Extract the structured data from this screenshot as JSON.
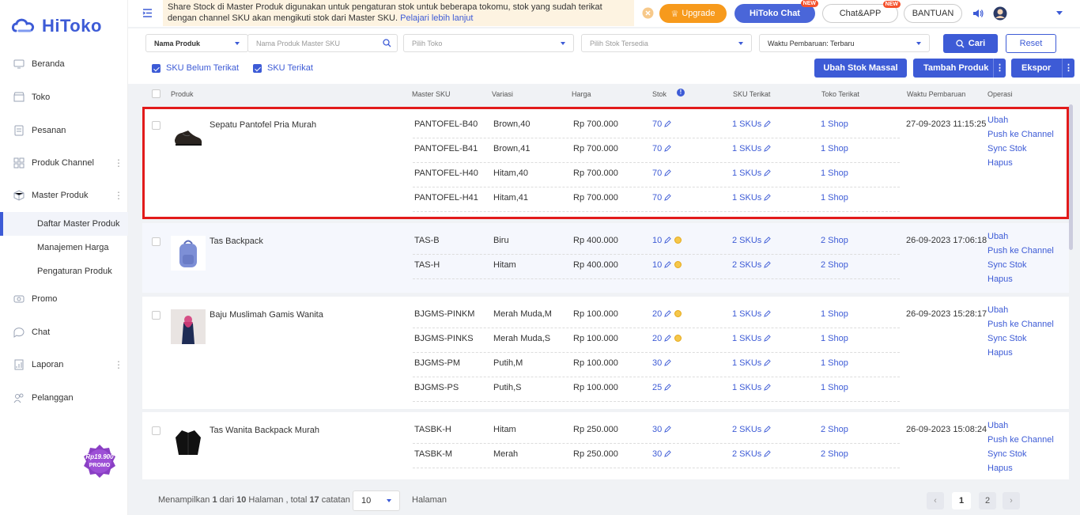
{
  "app": {
    "logo_text": "HiToko"
  },
  "sidebar": {
    "items": [
      {
        "label": "Beranda",
        "icon": "monitor-icon"
      },
      {
        "label": "Toko",
        "icon": "store-icon"
      },
      {
        "label": "Pesanan",
        "icon": "list-icon"
      },
      {
        "label": "Produk Channel",
        "icon": "grid-icon"
      },
      {
        "label": "Master Produk",
        "icon": "cube-icon"
      },
      {
        "label": "Promo",
        "icon": "promo-icon"
      },
      {
        "label": "Chat",
        "icon": "chat-icon"
      },
      {
        "label": "Laporan",
        "icon": "report-icon"
      },
      {
        "label": "Pelanggan",
        "icon": "users-icon"
      }
    ],
    "subitems": [
      {
        "label": "Daftar Master Produk"
      },
      {
        "label": "Manajemen Harga"
      },
      {
        "label": "Pengaturan Produk"
      }
    ],
    "promo_badge": {
      "price": "Rp19.900",
      "label": "PROMO"
    }
  },
  "topbar": {
    "notice_text": "Share Stock di Master Produk digunakan untuk pengaturan stok untuk beberapa tokomu, stok yang sudah terikat dengan channel SKU akan mengikuti stok dari Master SKU.",
    "notice_link": "Pelajari lebih lanjut",
    "upgrade": "Upgrade",
    "hitoko_chat": "HiToko Chat",
    "chat_app": "Chat&APP",
    "new_tag": "NEW",
    "bantuan": "BANTUAN"
  },
  "filters": {
    "search_field": "Nama Produk",
    "search_placeholder": "Nama Produk Master SKU",
    "toko_placeholder": "Pilih Toko",
    "stok_placeholder": "Pilih Stok Tersedia",
    "sort": "Waktu Pembaruan: Terbaru",
    "cari": "Cari",
    "reset": "Reset",
    "sku_belum": "SKU Belum Terikat",
    "sku_terikat": "SKU Terikat",
    "ubah_stok": "Ubah Stok Massal",
    "tambah_produk": "Tambah Produk",
    "ekspor": "Ekspor"
  },
  "table": {
    "headers": [
      "Produk",
      "Master SKU",
      "Variasi",
      "Harga",
      "Stok",
      "SKU Terikat",
      "Toko Terikat",
      "Waktu Pembaruan",
      "Operasi"
    ],
    "operations": [
      "Ubah",
      "Push ke Channel",
      "Sync Stok",
      "Hapus"
    ],
    "products": [
      {
        "name": "Sepatu Pantofel Pria Murah",
        "updated": "27-09-2023 11:15:25",
        "thumb": "shoe",
        "rows": [
          {
            "sku": "PANTOFEL-B40",
            "variant": "Brown,40",
            "price": "Rp 700.000",
            "stock": "70",
            "coin": false,
            "skus": "1 SKUs",
            "shops": "1 Shop"
          },
          {
            "sku": "PANTOFEL-B41",
            "variant": "Brown,41",
            "price": "Rp 700.000",
            "stock": "70",
            "coin": false,
            "skus": "1 SKUs",
            "shops": "1 Shop"
          },
          {
            "sku": "PANTOFEL-H40",
            "variant": "Hitam,40",
            "price": "Rp 700.000",
            "stock": "70",
            "coin": false,
            "skus": "1 SKUs",
            "shops": "1 Shop"
          },
          {
            "sku": "PANTOFEL-H41",
            "variant": "Hitam,41",
            "price": "Rp 700.000",
            "stock": "70",
            "coin": false,
            "skus": "1 SKUs",
            "shops": "1 Shop"
          }
        ]
      },
      {
        "name": "Tas Backpack",
        "updated": "26-09-2023 17:06:18",
        "thumb": "backpack",
        "rows": [
          {
            "sku": "TAS-B",
            "variant": "Biru",
            "price": "Rp 400.000",
            "stock": "10",
            "coin": true,
            "skus": "2 SKUs",
            "shops": "2 Shop"
          },
          {
            "sku": "TAS-H",
            "variant": "Hitam",
            "price": "Rp 400.000",
            "stock": "10",
            "coin": true,
            "skus": "2 SKUs",
            "shops": "2 Shop"
          }
        ]
      },
      {
        "name": "Baju Muslimah Gamis Wanita",
        "updated": "26-09-2023 15:28:17",
        "thumb": "dress",
        "rows": [
          {
            "sku": "BJGMS-PINKM",
            "variant": "Merah Muda,M",
            "price": "Rp 100.000",
            "stock": "20",
            "coin": true,
            "skus": "1 SKUs",
            "shops": "1 Shop"
          },
          {
            "sku": "BJGMS-PINKS",
            "variant": "Merah Muda,S",
            "price": "Rp 100.000",
            "stock": "20",
            "coin": true,
            "skus": "1 SKUs",
            "shops": "1 Shop"
          },
          {
            "sku": "BJGMS-PM",
            "variant": "Putih,M",
            "price": "Rp 100.000",
            "stock": "30",
            "coin": false,
            "skus": "1 SKUs",
            "shops": "1 Shop"
          },
          {
            "sku": "BJGMS-PS",
            "variant": "Putih,S",
            "price": "Rp 100.000",
            "stock": "25",
            "coin": false,
            "skus": "1 SKUs",
            "shops": "1 Shop"
          }
        ]
      },
      {
        "name": "Tas Wanita Backpack Murah",
        "updated": "26-09-2023 15:08:24",
        "thumb": "jacket",
        "rows": [
          {
            "sku": "TASBK-H",
            "variant": "Hitam",
            "price": "Rp 250.000",
            "stock": "30",
            "coin": false,
            "skus": "2 SKUs",
            "shops": "2 Shop"
          },
          {
            "sku": "TASBK-M",
            "variant": "Merah",
            "price": "Rp 250.000",
            "stock": "30",
            "coin": false,
            "skus": "2 SKUs",
            "shops": "2 Shop"
          }
        ]
      }
    ]
  },
  "footer": {
    "summary_prefix": "Menampilkan",
    "page_current": "1",
    "summary_mid": "dari",
    "page_total": "10",
    "summary_mid2": "Halaman , total",
    "record_total": "17",
    "summary_suffix": "catatan",
    "page_size": "10",
    "halaman": "Halaman",
    "pages": [
      "1",
      "2"
    ]
  },
  "colors": {
    "accent": "#3d5bd6",
    "highlight": "#e21b1b",
    "upgrade": "#f79a1c"
  }
}
